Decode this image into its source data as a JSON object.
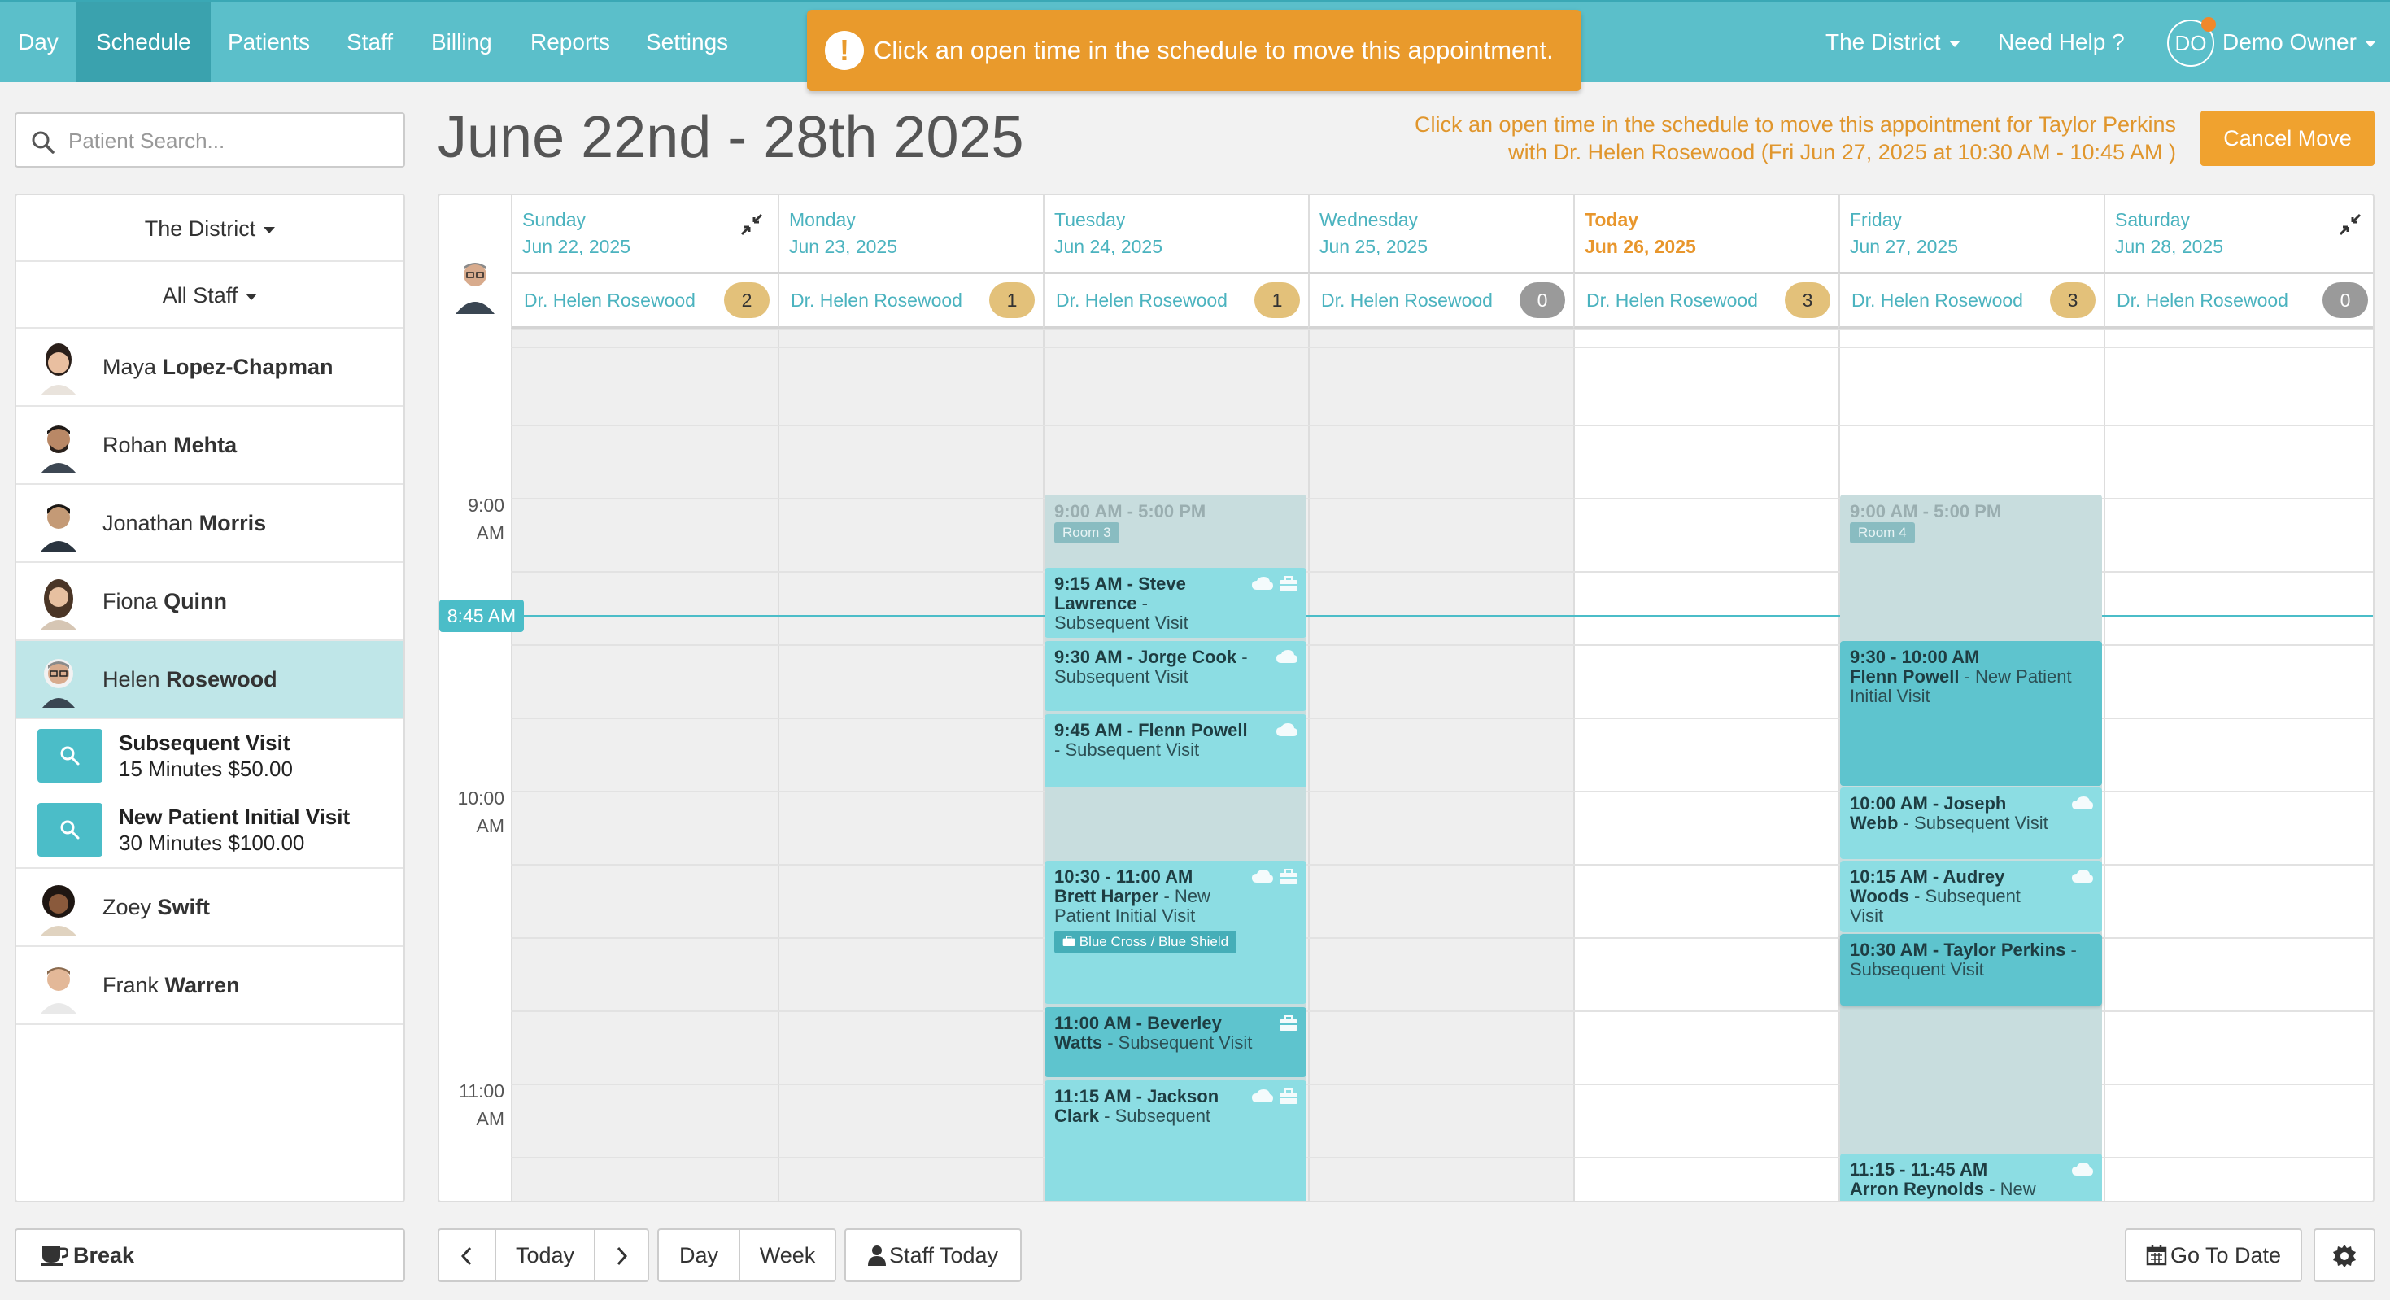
{
  "nav": {
    "items": [
      "Day",
      "Schedule",
      "Patients",
      "Staff",
      "Billing",
      "Reports",
      "Settings"
    ],
    "active": "Schedule",
    "location": "The District",
    "help": "Need Help ?",
    "user_initials": "DO",
    "user_name": "Demo Owner",
    "alert": "Click an open time in the schedule to move this appointment."
  },
  "sidebar": {
    "search_placeholder": "Patient Search...",
    "location_filter": "The District",
    "staff_filter": "All Staff",
    "staff": [
      {
        "first": "Maya",
        "last": "Lopez-Chapman"
      },
      {
        "first": "Rohan",
        "last": "Mehta"
      },
      {
        "first": "Jonathan",
        "last": "Morris"
      },
      {
        "first": "Fiona",
        "last": "Quinn"
      },
      {
        "first": "Helen",
        "last": "Rosewood"
      },
      {
        "first": "Zoey",
        "last": "Swift"
      },
      {
        "first": "Frank",
        "last": "Warren"
      }
    ],
    "services": [
      {
        "name": "Subsequent Visit",
        "details": "15 Minutes $50.00"
      },
      {
        "name": "New Patient Initial Visit",
        "details": "30 Minutes $100.00"
      }
    ],
    "break_label": "Break"
  },
  "header": {
    "title": "June 22nd - 28th 2025",
    "move_message_line1": "Click an open time in the schedule to move this appointment for Taylor Perkins",
    "move_message_line2": "with Dr. Helen Rosewood (Fri Jun 27, 2025 at 10:30 AM - 10:45 AM )",
    "cancel_label": "Cancel Move"
  },
  "calendar": {
    "days": [
      {
        "name": "Sunday",
        "date": "Jun 22, 2025",
        "staff": "Dr. Helen Rosewood",
        "count": "2"
      },
      {
        "name": "Monday",
        "date": "Jun 23, 2025",
        "staff": "Dr. Helen Rosewood",
        "count": "1"
      },
      {
        "name": "Tuesday",
        "date": "Jun 24, 2025",
        "staff": "Dr. Helen Rosewood",
        "count": "1"
      },
      {
        "name": "Wednesday",
        "date": "Jun 25, 2025",
        "staff": "Dr. Helen Rosewood",
        "count": "0"
      },
      {
        "name": "Today",
        "date": "Jun 26, 2025",
        "staff": "Dr. Helen Rosewood",
        "count": "3"
      },
      {
        "name": "Friday",
        "date": "Jun 27, 2025",
        "staff": "Dr. Helen Rosewood",
        "count": "3"
      },
      {
        "name": "Saturday",
        "date": "Jun 28, 2025",
        "staff": "Dr. Helen Rosewood",
        "count": "0"
      }
    ],
    "now_time": "8:45 AM",
    "time_labels": [
      {
        "hour": "9:00",
        "ampm": "AM"
      },
      {
        "hour": "10:00",
        "ampm": "AM"
      },
      {
        "hour": "11:00",
        "ampm": "AM"
      }
    ],
    "availability": [
      {
        "time": "9:00 AM - 5:00 PM",
        "room": "Room 3"
      },
      {
        "time": "9:00 AM - 5:00 PM",
        "room": "Room 4"
      }
    ],
    "appointments": [
      {
        "head": "9:15 AM - Steve Lawrence",
        "sep": " - ",
        "rest": "Subsequent Visit"
      },
      {
        "head": "9:30 AM - Jorge Cook",
        "sep": " - ",
        "rest": "Subsequent Visit"
      },
      {
        "head": "9:45 AM - Flenn Powell",
        "sep": " - ",
        "rest": "Subsequent Visit"
      },
      {
        "head": "10:30 - 11:00 AM",
        "sub": "Brett Harper",
        "rest": " - New Patient Initial Visit",
        "insurance": "Blue Cross / Blue Shield"
      },
      {
        "head": "11:00 AM - Beverley Watts",
        "sep": " - ",
        "rest": "Subsequent Visit"
      },
      {
        "head": "11:15 AM - Jackson Clark",
        "sep": " - ",
        "rest": "Subsequent"
      },
      {
        "head": "9:30 - 10:00 AM",
        "sub": "Flenn Powell",
        "rest": " - New Patient Initial Visit"
      },
      {
        "head": "10:00 AM - Joseph Webb",
        "sep": " - ",
        "rest": "Subsequent Visit"
      },
      {
        "head": "10:15 AM - Audrey Woods",
        "sep": " - ",
        "rest": "Subsequent Visit"
      },
      {
        "head": "10:30 AM - Taylor Perkins",
        "sep": " - ",
        "rest": "Subsequent Visit"
      },
      {
        "head": "11:15 - 11:45 AM",
        "sub": "Arron Reynolds",
        "rest": " - New"
      }
    ]
  },
  "toolbar": {
    "today": "Today",
    "day": "Day",
    "week": "Week",
    "staff_today": "Staff Today",
    "go_to_date": "Go To Date"
  },
  "colors": {
    "nav_bg": "#5bbfca",
    "nav_active": "#3aa2ae",
    "alert": "#e99a2c",
    "today_accent": "#e8962c",
    "appointment": "#8cdde3",
    "appointment_dark": "#5ec4ce",
    "availability": "#c8ddde"
  }
}
